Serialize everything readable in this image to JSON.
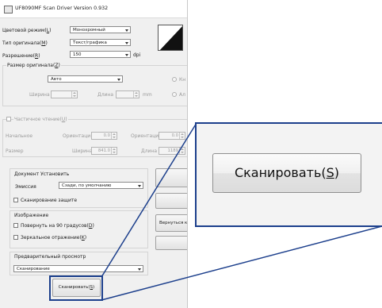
{
  "window": {
    "title": "UF8090MF Scan Driver Version 0.932"
  },
  "color_mode": {
    "label": "Цветовой режим(",
    "hotkey": "L",
    "suffix": ")",
    "value": "Монохромный"
  },
  "original_type": {
    "label": "Тип оригинала(",
    "hotkey": "M",
    "suffix": ")",
    "value": "Текст/графика"
  },
  "resolution": {
    "label": "Разрешение(",
    "hotkey": "R",
    "suffix": ")",
    "value": "150",
    "unit": "dpi"
  },
  "original_size": {
    "label": "Размер оригинала(",
    "hotkey": "Z",
    "suffix": ")",
    "value": "Авто",
    "width_label": "Ширина",
    "length_label": "Длина",
    "unit": "mm",
    "radio1": "Кн",
    "radio2": "Ал"
  },
  "partial_read": {
    "label": "Частичное чтение(",
    "hotkey": "U",
    "suffix": ")",
    "start_label": "Начальное",
    "orientation_label": "Ориентация",
    "orientation_value1": "0.0",
    "orientation_value2": "0.0",
    "size_label": "Размер",
    "width_label": "Ширина",
    "width_value": "841.0",
    "length_label": "Длина",
    "length_value": "1189"
  },
  "document_settings": {
    "title": "Документ Установить",
    "emission_label": "Эмиссия",
    "emission_value": "Сзади, по умолчанию",
    "protection_label": "Сканирование защите"
  },
  "image": {
    "title": "Изображение",
    "rotate_label": "Повернуть на 90 градусов(",
    "rotate_hotkey": "D",
    "rotate_suffix": ")",
    "mirror_label": "Зеркальное отражение(",
    "mirror_hotkey": "K",
    "mirror_suffix": ")"
  },
  "preview": {
    "title": "Предварительный просмотр",
    "value": "Сканирование"
  },
  "side_buttons": {
    "return_label": "Вернуться к"
  },
  "scan_button": {
    "label_prefix": "Сканировать(",
    "hotkey": "S",
    "label_suffix": ")"
  },
  "zoom_callout": {
    "label_prefix": "Сканировать(",
    "hotkey": "S",
    "label_suffix": ")"
  },
  "colors": {
    "callout_border": "#1c3f8c",
    "dialog_bg": "#f0f0f0"
  }
}
